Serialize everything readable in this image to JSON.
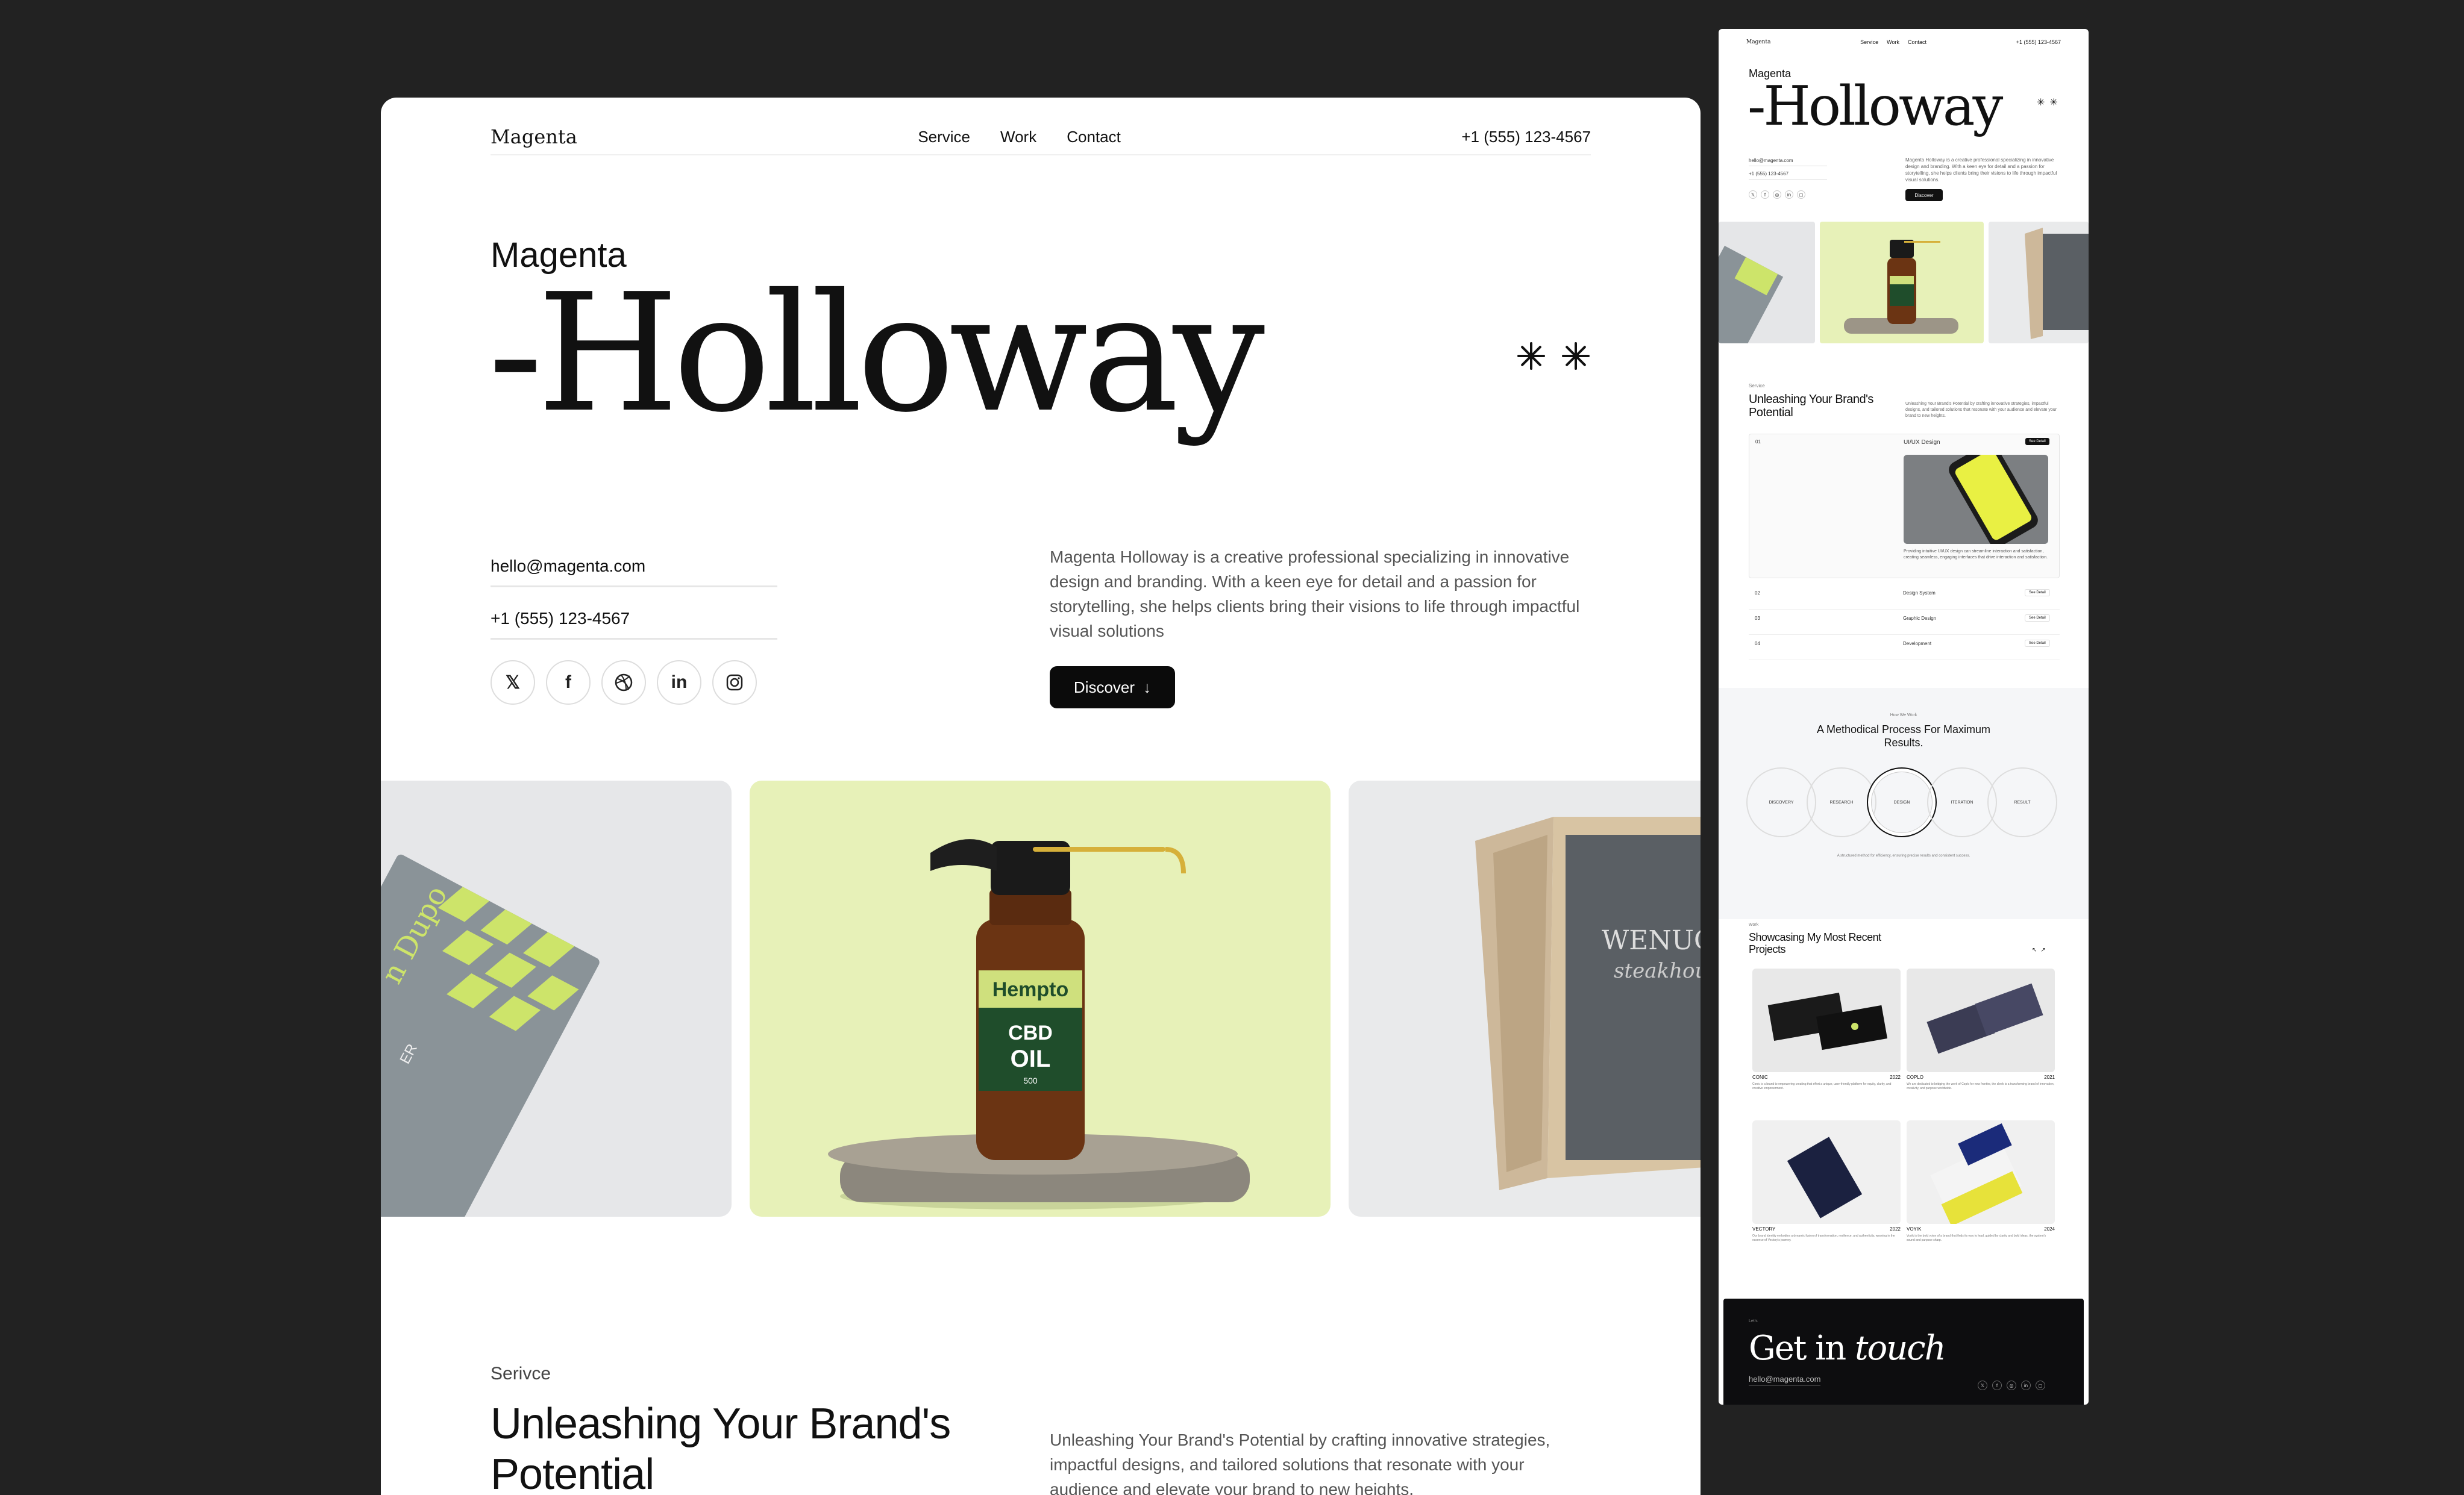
{
  "main": {
    "nav": {
      "logo": "Magenta",
      "links": [
        "Service",
        "Work",
        "Contact"
      ],
      "phone": "+1 (555) 123-4567"
    },
    "hero": {
      "kicker": "Magenta",
      "title": "-Holloway"
    },
    "contact": {
      "email": "hello@magenta.com",
      "phone": "+1 (555) 123-4567"
    },
    "social_icons": [
      "x-icon",
      "facebook-icon",
      "dribbble-icon",
      "linkedin-icon",
      "instagram-icon"
    ],
    "description": "Magenta Holloway is a creative professional specializing in innovative design and branding. With a keen eye for detail and a passion for storytelling, she helps clients bring their visions to life through impactful visual solutions",
    "discover_label": "Discover",
    "gallery": {
      "card1": {
        "name_fragment": "n Dupo",
        "role_fragment": "ER"
      },
      "card2": {
        "brand": "Hempto",
        "product_line1": "CBD",
        "product_line2": "OIL",
        "dose": "500"
      },
      "card3": {
        "sign_title": "WENUQ",
        "sign_script": "steakhous"
      }
    },
    "service": {
      "kicker": "Serivce",
      "title": "Unleashing Your Brand's Potential",
      "description": "Unleashing Your Brand's Potential by crafting innovative strategies, impactful designs, and tailored solutions that resonate with your audience and elevate your brand to new heights."
    }
  },
  "side": {
    "nav": {
      "logo": "Magenta",
      "links": [
        "Service",
        "Work",
        "Contact"
      ],
      "phone": "+1 (555) 123-4567"
    },
    "hero": {
      "kicker": "Magenta",
      "title": "-Holloway"
    },
    "contact": {
      "email": "hello@magenta.com",
      "phone": "+1 (555) 123-4567"
    },
    "description": "Magenta Holloway is a creative professional specializing in innovative design and branding. With a keen eye for detail and a passion for storytelling, she helps clients bring their visions to life through impactful visual solutions.",
    "discover_label": "Discover",
    "service": {
      "kicker": "Service",
      "title": "Unleashing Your Brand's Potential",
      "description": "Unleashing Your Brand's Potential by crafting innovative strategies, impactful designs, and tailored solutions that resonate with your audience and elevate your brand to new heights.",
      "items": [
        {
          "num": "01",
          "label": "UI/UX Design",
          "action": "See Detail",
          "text": "Providing intuitive UI/UX design can streamline interaction and satisfaction, creating seamless, engaging interfaces that drive interaction and satisfaction."
        },
        {
          "num": "02",
          "label": "Design System",
          "action": "See Detail"
        },
        {
          "num": "03",
          "label": "Graphic Design",
          "action": "See Detail"
        },
        {
          "num": "04",
          "label": "Development",
          "action": "See Detail"
        }
      ]
    },
    "process": {
      "kicker": "How We Work",
      "title": "A Methodical Process For Maximum Results.",
      "steps": [
        "DISCOVERY",
        "RESEARCH",
        "DESIGN",
        "ITERATION",
        "RESULT"
      ],
      "caption": "A structured method for efficiency, ensuring precise results and consistent success."
    },
    "work": {
      "kicker": "Work",
      "title": "Showcasing My Most Recent Projects",
      "projects": [
        {
          "name": "CONIC",
          "year": "2022",
          "text": "Conic is a brand to empowering creating that effort a unique, user-friendly platform for equity, clarity, and creative empowerment."
        },
        {
          "name": "COPLO",
          "year": "2021",
          "text": "We are dedicated to bridging the work of Coplo for new frontier, the sleek is a transforming brand of innovation, creativity, and purpose worldwide."
        },
        {
          "name": "VECTORY",
          "year": "2022",
          "text": "Our brand identity embodies a dynamic fusion of transformation, resilience, and authenticity, weaving in the essence of Vectory's journey."
        },
        {
          "name": "VOYIK",
          "year": "2024",
          "text": "Voyik is the bold voice of a brand that finds its way to lead, guided by clarity and bold ideas, the system's sound and purpose sharp."
        }
      ]
    },
    "footer": {
      "kicker": "Let's",
      "title_plain": "Get in",
      "title_italic": "touch",
      "email": "hello@magenta.com"
    }
  }
}
